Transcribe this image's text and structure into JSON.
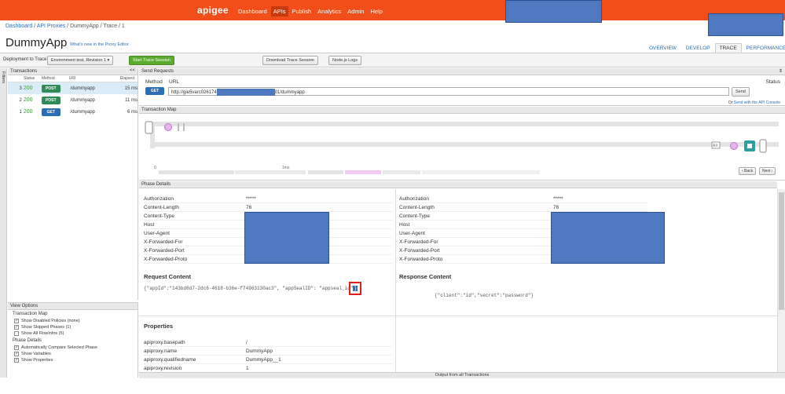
{
  "topbar": {
    "logo": "apigee",
    "nav": [
      "Dashboard",
      "APIs",
      "Publish",
      "Analytics",
      "Admin",
      "Help"
    ],
    "active": "APIs"
  },
  "breadcrumb": {
    "dashboard": "Dashboard",
    "sep1": " / ",
    "proxies": "API Proxies",
    "sep2": " / ",
    "proxy": "DummyApp",
    "sep3": " / ",
    "trace": "Trace",
    "sep4": " / ",
    "rev": "1"
  },
  "page": {
    "title": "DummyApp",
    "whats_new": "What's new in the Proxy Editor"
  },
  "tabs": [
    "OVERVIEW",
    "DEVELOP",
    "TRACE",
    "PERFORMANCE"
  ],
  "toolbar": {
    "deploy_label": "Deployment to Trace",
    "env_select": "Environment test, Revision 1 ▾",
    "start_btn": "Start Trace Session",
    "download_btn": "Download Trace Session",
    "nodejs_btn": "Node.js Logs"
  },
  "filters_label": "Filters",
  "transactions": {
    "title": "Transactions",
    "collapse": "<<",
    "headers": {
      "status": "Status",
      "method": "Method",
      "uri": "URI",
      "elapsed": "Elapsed"
    },
    "rows": [
      {
        "n": "3",
        "status": "200",
        "method": "POST",
        "uri": "/dummyapp",
        "elapsed": "15 ms"
      },
      {
        "n": "2",
        "status": "200",
        "method": "POST",
        "uri": "/dummyapp",
        "elapsed": "11 ms"
      },
      {
        "n": "1",
        "status": "200",
        "method": "GET",
        "uri": "/dummyapp",
        "elapsed": "6 ms"
      }
    ]
  },
  "view_options": {
    "title": "View Options",
    "map_title": "Transaction Map",
    "map_opts": [
      {
        "label": "Show Disabled Policies (none)",
        "checked": true
      },
      {
        "label": "Show Skipped Phases (1)",
        "checked": true
      },
      {
        "label": "Show All FlowInfos (5)",
        "checked": false
      }
    ],
    "phase_title": "Phase Details",
    "phase_opts": [
      {
        "label": "Automatically Compare Selected Phase",
        "checked": true
      },
      {
        "label": "Show Variables",
        "checked": true
      },
      {
        "label": "Show Properties",
        "checked": true
      }
    ]
  },
  "send_requests": {
    "title": "Send Requests",
    "method_label": "Method",
    "url_label": "URL",
    "status_label": "Status",
    "method": "GET",
    "url_prefix": "http://gie5varc026174",
    "url_suffix": "01/dummyapp",
    "send_btn": "Send",
    "or_text": "Or ",
    "console_link": "Send with the API Console"
  },
  "transaction_map": {
    "title": "Transaction Map",
    "time0": "0",
    "time1": "1ms",
    "back_btn": "‹ Back",
    "next_btn": "Next ›",
    "ax_label": "AX"
  },
  "phase_details": {
    "title": "Phase Details",
    "headers_left": [
      {
        "k": "Authorization",
        "v": "*****"
      },
      {
        "k": "Content-Length",
        "v": "76"
      },
      {
        "k": "Content-Type",
        "v": ""
      },
      {
        "k": "Host",
        "v": ""
      },
      {
        "k": "User-Agent",
        "v": ""
      },
      {
        "k": "X-Forwarded-For",
        "v": ""
      },
      {
        "k": "X-Forwarded-Port",
        "v": ""
      },
      {
        "k": "X-Forwarded-Proto",
        "v": ""
      }
    ],
    "headers_right": [
      {
        "k": "Authorization",
        "v": "*****"
      },
      {
        "k": "Content-Length",
        "v": "76"
      },
      {
        "k": "Content-Type",
        "v": ""
      },
      {
        "k": "Host",
        "v": ""
      },
      {
        "k": "User-Agent",
        "v": ""
      },
      {
        "k": "X-Forwarded-For",
        "v": ""
      },
      {
        "k": "X-Forwarded-Port",
        "v": ""
      },
      {
        "k": "X-Forwarded-Proto",
        "v": ""
      }
    ],
    "request_content_title": "Request Content",
    "request_content": "{\"appId\":\"143bd8d7-2dc6-4618-b36e-f74963130ac3\", \"appSealID\": \"appseal_id\"",
    "request_content_highlight": "}",
    "response_content_title": "Response Content",
    "response_content": "{\"client\":\"id\",\"secret\":\"password\"}",
    "properties_title": "Properties",
    "properties": [
      {
        "k": "apiproxy.basepath",
        "v": "/"
      },
      {
        "k": "apiproxy.name",
        "v": "DummyApp"
      },
      {
        "k": "apiproxy.qualifiedname",
        "v": "DummyApp__1"
      },
      {
        "k": "apiproxy.revision",
        "v": "1"
      }
    ]
  },
  "footer": "Output from all Transactions",
  "colors": {
    "brand": "#f24e19",
    "post": "#2e8b57",
    "get": "#2a6fb6",
    "start": "#5aaa2f",
    "redaction": "#4e79c0"
  }
}
